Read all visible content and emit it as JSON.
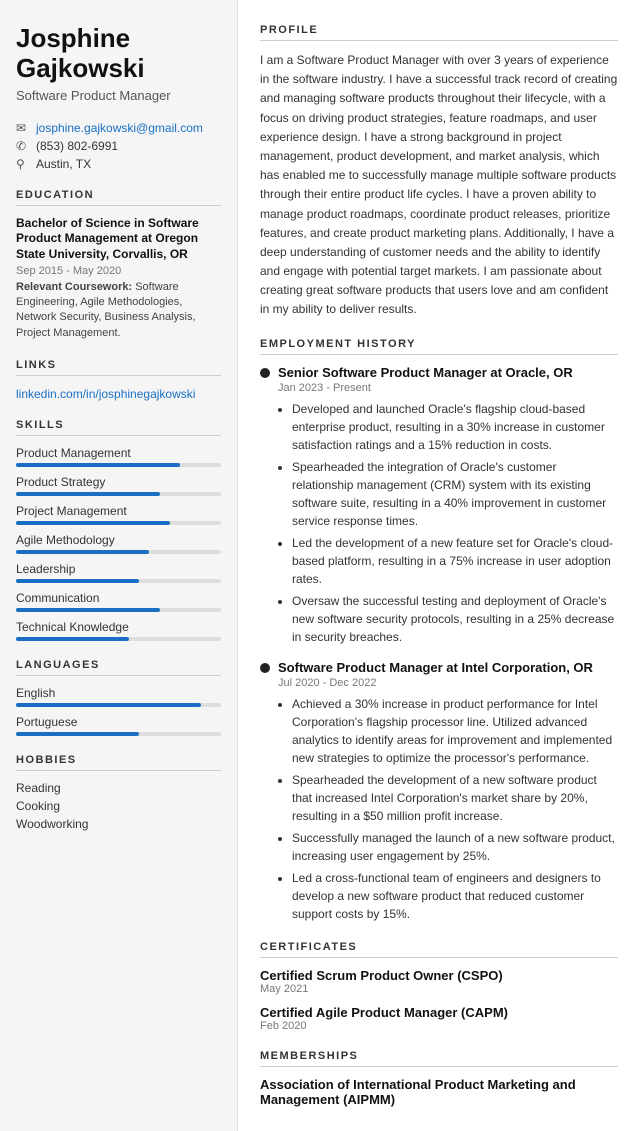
{
  "sidebar": {
    "name": "Josphine Gajkowski",
    "title": "Software Product Manager",
    "contact": {
      "email": "josphine.gajkowski@gmail.com",
      "phone": "(853) 802-6991",
      "location": "Austin, TX"
    },
    "education": {
      "degree": "Bachelor of Science in Software Product Management at Oregon State University, Corvallis, OR",
      "dates": "Sep 2015 - May 2020",
      "coursework_label": "Relevant Coursework:",
      "coursework": "Software Engineering, Agile Methodologies, Network Security, Business Analysis, Project Management."
    },
    "links_label": "LINKS",
    "links": [
      {
        "text": "linkedin.com/in/josphinegajkowski",
        "url": "#"
      }
    ],
    "skills_label": "SKILLS",
    "skills": [
      {
        "label": "Product Management",
        "pct": 80
      },
      {
        "label": "Product Strategy",
        "pct": 70
      },
      {
        "label": "Project Management",
        "pct": 75
      },
      {
        "label": "Agile Methodology",
        "pct": 65
      },
      {
        "label": "Leadership",
        "pct": 60
      },
      {
        "label": "Communication",
        "pct": 70
      },
      {
        "label": "Technical Knowledge",
        "pct": 55
      }
    ],
    "languages_label": "LANGUAGES",
    "languages": [
      {
        "label": "English",
        "pct": 90
      },
      {
        "label": "Portuguese",
        "pct": 60
      }
    ],
    "hobbies_label": "HOBBIES",
    "hobbies": [
      "Reading",
      "Cooking",
      "Woodworking"
    ]
  },
  "main": {
    "profile_label": "PROFILE",
    "profile_text": "I am a Software Product Manager with over 3 years of experience in the software industry. I have a successful track record of creating and managing software products throughout their lifecycle, with a focus on driving product strategies, feature roadmaps, and user experience design. I have a strong background in project management, product development, and market analysis, which has enabled me to successfully manage multiple software products through their entire product life cycles. I have a proven ability to manage product roadmaps, coordinate product releases, prioritize features, and create product marketing plans. Additionally, I have a deep understanding of customer needs and the ability to identify and engage with potential target markets. I am passionate about creating great software products that users love and am confident in my ability to deliver results.",
    "employment_label": "EMPLOYMENT HISTORY",
    "jobs": [
      {
        "title": "Senior Software Product Manager at Oracle, OR",
        "dates": "Jan 2023 - Present",
        "bullets": [
          "Developed and launched Oracle's flagship cloud-based enterprise product, resulting in a 30% increase in customer satisfaction ratings and a 15% reduction in costs.",
          "Spearheaded the integration of Oracle's customer relationship management (CRM) system with its existing software suite, resulting in a 40% improvement in customer service response times.",
          "Led the development of a new feature set for Oracle's cloud-based platform, resulting in a 75% increase in user adoption rates.",
          "Oversaw the successful testing and deployment of Oracle's new software security protocols, resulting in a 25% decrease in security breaches."
        ]
      },
      {
        "title": "Software Product Manager at Intel Corporation, OR",
        "dates": "Jul 2020 - Dec 2022",
        "bullets": [
          "Achieved a 30% increase in product performance for Intel Corporation's flagship processor line. Utilized advanced analytics to identify areas for improvement and implemented new strategies to optimize the processor's performance.",
          "Spearheaded the development of a new software product that increased Intel Corporation's market share by 20%, resulting in a $50 million profit increase.",
          "Successfully managed the launch of a new software product, increasing user engagement by 25%.",
          "Led a cross-functional team of engineers and designers to develop a new software product that reduced customer support costs by 15%."
        ]
      }
    ],
    "certificates_label": "CERTIFICATES",
    "certificates": [
      {
        "name": "Certified Scrum Product Owner (CSPO)",
        "date": "May 2021"
      },
      {
        "name": "Certified Agile Product Manager (CAPM)",
        "date": "Feb 2020"
      }
    ],
    "memberships_label": "MEMBERSHIPS",
    "memberships": [
      {
        "name": "Association of International Product Marketing and Management (AIPMM)"
      }
    ]
  }
}
